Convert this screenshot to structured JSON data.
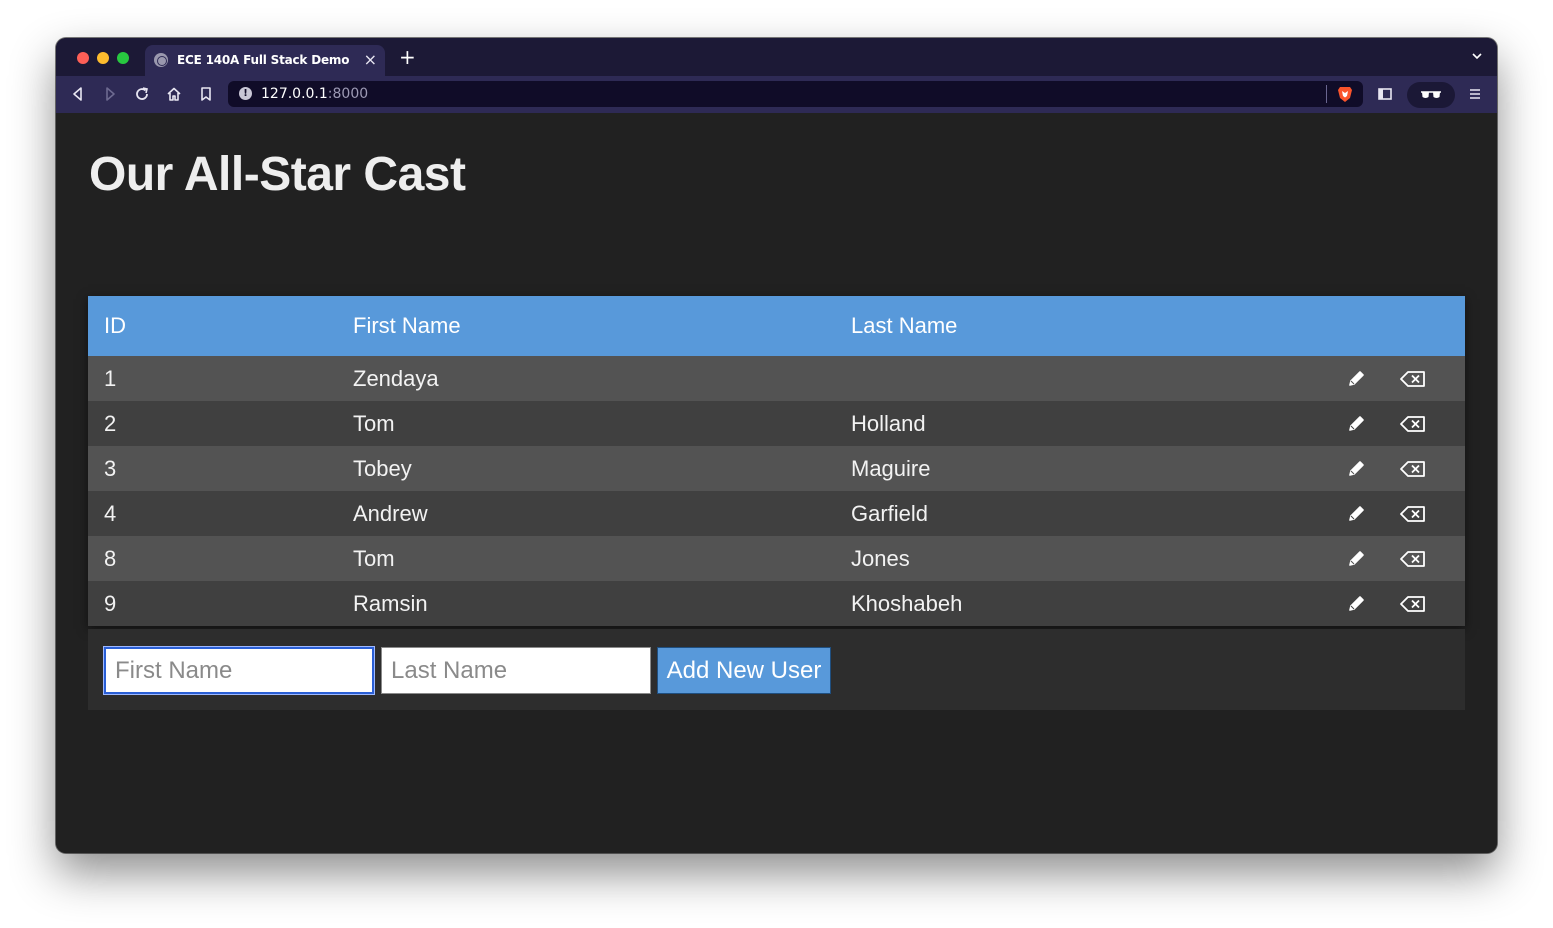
{
  "browser": {
    "tab_title": "ECE 140A Full Stack Demo",
    "tab_close": "×",
    "new_tab": "+",
    "url_host": "127.0.0.1",
    "url_port": ":8000",
    "url_info": "!"
  },
  "page": {
    "title": "Our All-Star Cast"
  },
  "table": {
    "headers": [
      "ID",
      "First Name",
      "Last Name"
    ],
    "rows": [
      {
        "id": "1",
        "first": "Zendaya",
        "last": ""
      },
      {
        "id": "2",
        "first": "Tom",
        "last": "Holland"
      },
      {
        "id": "3",
        "first": "Tobey",
        "last": "Maguire"
      },
      {
        "id": "4",
        "first": "Andrew",
        "last": "Garfield"
      },
      {
        "id": "8",
        "first": "Tom",
        "last": "Jones"
      },
      {
        "id": "9",
        "first": "Ramsin",
        "last": "Khoshabeh"
      }
    ]
  },
  "form": {
    "first_placeholder": "First Name",
    "last_placeholder": "Last Name",
    "add_label": "Add New User"
  },
  "colors": {
    "header_bg": "#5899da",
    "row_odd": "#535353",
    "row_even": "#404040",
    "page_bg": "#212121",
    "browser_chrome": "#2e2a55"
  },
  "icons": {
    "edit": "pencil-icon",
    "delete": "backspace-icon"
  }
}
